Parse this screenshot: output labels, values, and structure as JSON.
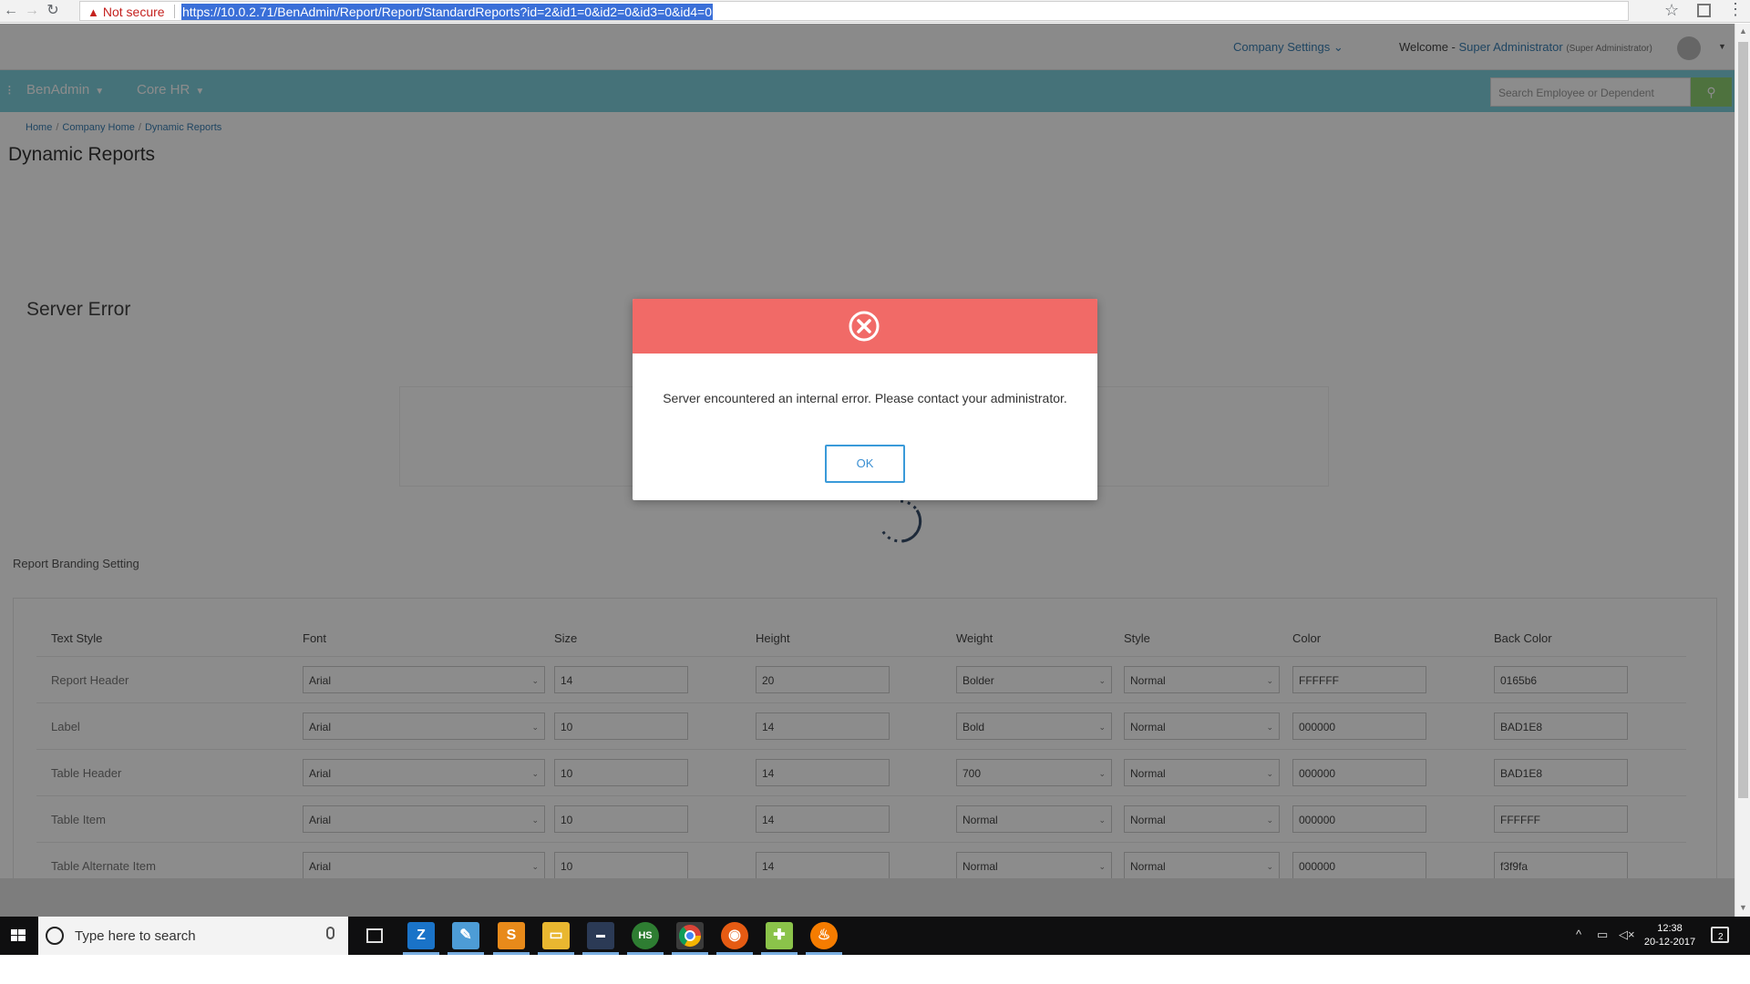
{
  "browser": {
    "security_label": "Not secure",
    "url": "https://10.0.2.71/BenAdmin/Report/Report/StandardReports?id=2&id1=0&id2=0&id3=0&id4=0"
  },
  "topbar": {
    "company_settings": "Company Settings",
    "welcome_prefix": "Welcome -",
    "user_name": "Super Administrator",
    "user_role": "(Super Administrator)"
  },
  "nav": {
    "items": [
      {
        "label": "BenAdmin"
      },
      {
        "label": "Core HR"
      }
    ],
    "search_placeholder": "Search Employee or Dependent"
  },
  "breadcrumb": [
    "Home",
    "Company Home",
    "Dynamic Reports"
  ],
  "page_title": "Dynamic Reports",
  "server_error_heading": "Server Error",
  "branding": {
    "title": "Report Branding Setting",
    "columns": [
      "Text Style",
      "Font",
      "Size",
      "Height",
      "Weight",
      "Style",
      "Color",
      "Back Color"
    ],
    "rows": [
      {
        "text_style": "Report Header",
        "font": "Arial",
        "size": "14",
        "height": "20",
        "weight": "Bolder",
        "style": "Normal",
        "color": "FFFFFF",
        "back_color": "0165b6"
      },
      {
        "text_style": "Label",
        "font": "Arial",
        "size": "10",
        "height": "14",
        "weight": "Bold",
        "style": "Normal",
        "color": "000000",
        "back_color": "BAD1E8"
      },
      {
        "text_style": "Table Header",
        "font": "Arial",
        "size": "10",
        "height": "14",
        "weight": "700",
        "style": "Normal",
        "color": "000000",
        "back_color": "BAD1E8"
      },
      {
        "text_style": "Table Item",
        "font": "Arial",
        "size": "10",
        "height": "14",
        "weight": "Normal",
        "style": "Normal",
        "color": "000000",
        "back_color": "FFFFFF"
      },
      {
        "text_style": "Table Alternate Item",
        "font": "Arial",
        "size": "10",
        "height": "14",
        "weight": "Normal",
        "style": "Normal",
        "color": "000000",
        "back_color": "f3f9fa"
      }
    ]
  },
  "modal": {
    "message": "Server encountered an internal error. Please contact your administrator.",
    "ok_label": "OK",
    "header_color": "#f16a67"
  },
  "taskbar": {
    "search_placeholder": "Type here to search",
    "time": "12:38",
    "date": "20-12-2017",
    "notification_count": "2",
    "apps": [
      "zoom-icon",
      "notepad-icon",
      "sublime-icon",
      "file-explorer-icon",
      "cmd-icon",
      "hs-icon",
      "chrome-icon",
      "firefox-icon",
      "notepad-plus-icon",
      "fire-icon"
    ]
  },
  "colors": {
    "nav_bar": "#7fd0dc",
    "modal_header": "#f16a67",
    "ok_border": "#3a9ad9",
    "link": "#3a7fb2"
  }
}
